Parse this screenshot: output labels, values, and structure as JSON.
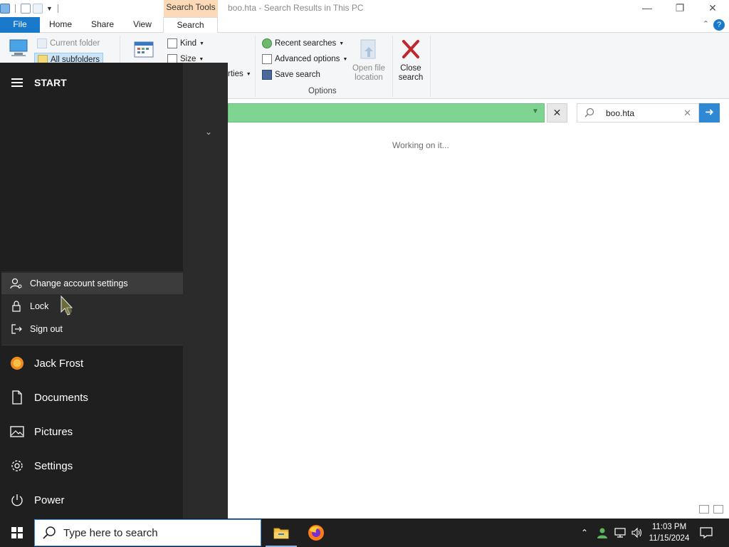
{
  "window": {
    "title": "boo.hta - Search Results in This PC",
    "context_group": "Search Tools",
    "minimize": "—",
    "restore": "❐",
    "close": "✕"
  },
  "tabs": [
    {
      "label": "File"
    },
    {
      "label": "Home"
    },
    {
      "label": "Share"
    },
    {
      "label": "View"
    },
    {
      "label": "Search"
    }
  ],
  "ribbon": {
    "location": {
      "current_folder": "Current folder",
      "all_subfolders": "All subfolders"
    },
    "refine": {
      "kind": "Kind",
      "size": "Size",
      "properties": "rties"
    },
    "options": {
      "recent_searches": "Recent searches",
      "advanced_options": "Advanced options",
      "save_search": "Save search",
      "open_file_location_l1": "Open file",
      "open_file_location_l2": "location",
      "close_search_l1": "Close",
      "close_search_l2": "search",
      "group_label": "Options"
    }
  },
  "search": {
    "query": "boo.hta"
  },
  "content": {
    "status": "Working on it..."
  },
  "start_menu": {
    "title": "START",
    "account_menu": [
      {
        "label": "Change account settings",
        "icon": "account-settings-icon"
      },
      {
        "label": "Lock",
        "icon": "lock-icon"
      },
      {
        "label": "Sign out",
        "icon": "sign-out-icon"
      }
    ],
    "nav": [
      {
        "label": "Jack Frost",
        "icon": "user-avatar"
      },
      {
        "label": "Documents",
        "icon": "document-icon"
      },
      {
        "label": "Pictures",
        "icon": "pictures-icon"
      },
      {
        "label": "Settings",
        "icon": "gear-icon"
      },
      {
        "label": "Power",
        "icon": "power-icon"
      }
    ]
  },
  "taskbar": {
    "search_placeholder": "Type here to search",
    "time": "11:03 PM",
    "date": "11/15/2024"
  },
  "colors": {
    "accent": "#1979ca",
    "address_progress": "#7fd491",
    "context_tab": "#fcd9b7",
    "start_bg": "#1f1f1f"
  }
}
